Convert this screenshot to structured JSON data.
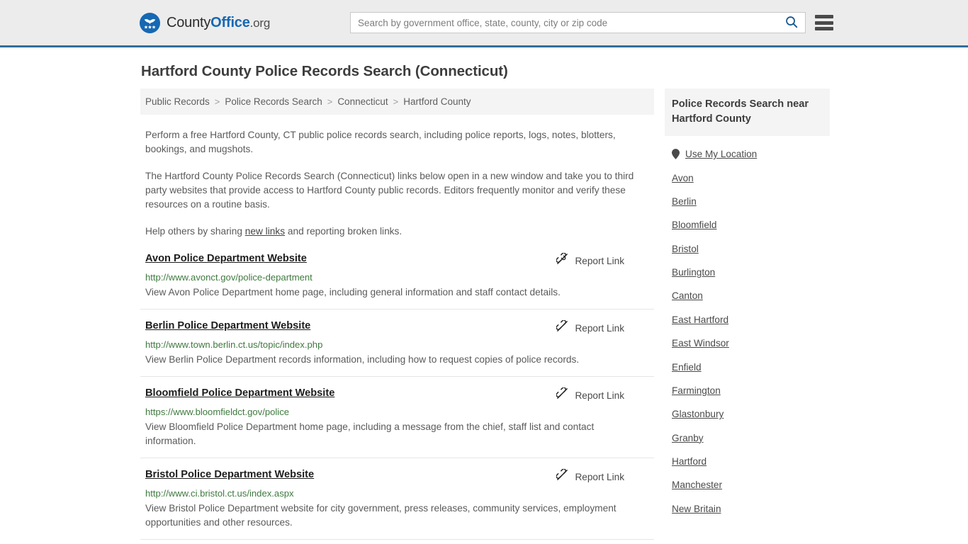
{
  "header": {
    "brand": {
      "part1": "County",
      "part2": "Office",
      "part3": ".org",
      "logo_icon": "eagle-shield-icon"
    },
    "search": {
      "placeholder": "Search by government office, state, county, city or zip code",
      "value": "",
      "search_icon": "search-icon"
    },
    "menu_icon": "hamburger-menu-icon",
    "background_color": "#ececec",
    "accent_color": "#336e9e"
  },
  "page": {
    "title": "Hartford County Police Records Search (Connecticut)"
  },
  "breadcrumb": {
    "separator": ">",
    "items": [
      {
        "label": "Public Records"
      },
      {
        "label": "Police Records Search"
      },
      {
        "label": "Connecticut"
      },
      {
        "label": "Hartford County"
      }
    ]
  },
  "intro": {
    "p1": "Perform a free Hartford County, CT public police records search, including police reports, logs, notes, blotters, bookings, and mugshots.",
    "p2": "The Hartford County Police Records Search (Connecticut) links below open in a new window and take you to third party websites that provide access to Hartford County public records. Editors frequently monitor and verify these resources on a routine basis.",
    "p3_before": "Help others by sharing ",
    "p3_link": "new links",
    "p3_after": " and reporting broken links."
  },
  "listings": {
    "report_link_label": "Report Link",
    "report_link_icon": "broken-link-icon",
    "url_color": "#3f7a3f",
    "items": [
      {
        "title": "Avon Police Department Website",
        "url": "http://www.avonct.gov/police-department",
        "description": "View Avon Police Department home page, including general information and staff contact details."
      },
      {
        "title": "Berlin Police Department Website",
        "url": "http://www.town.berlin.ct.us/topic/index.php",
        "description": "View Berlin Police Department records information, including how to request copies of police records."
      },
      {
        "title": "Bloomfield Police Department Website",
        "url": "https://www.bloomfieldct.gov/police",
        "description": "View Bloomfield Police Department home page, including a message from the chief, staff list and contact information."
      },
      {
        "title": "Bristol Police Department Website",
        "url": "http://www.ci.bristol.ct.us/index.aspx",
        "description": "View Bristol Police Department website for city government, press releases, community services, employment opportunities and other resources."
      }
    ]
  },
  "sidebar": {
    "heading": "Police Records Search near Hartford County",
    "items": [
      {
        "label": "Use My Location",
        "icon": "map-pin-icon"
      },
      {
        "label": "Avon",
        "icon": ""
      },
      {
        "label": "Berlin",
        "icon": ""
      },
      {
        "label": "Bloomfield",
        "icon": ""
      },
      {
        "label": "Bristol",
        "icon": ""
      },
      {
        "label": "Burlington",
        "icon": ""
      },
      {
        "label": "Canton",
        "icon": ""
      },
      {
        "label": "East Hartford",
        "icon": ""
      },
      {
        "label": "East Windsor",
        "icon": ""
      },
      {
        "label": "Enfield",
        "icon": ""
      },
      {
        "label": "Farmington",
        "icon": ""
      },
      {
        "label": "Glastonbury",
        "icon": ""
      },
      {
        "label": "Granby",
        "icon": ""
      },
      {
        "label": "Hartford",
        "icon": ""
      },
      {
        "label": "Manchester",
        "icon": ""
      },
      {
        "label": "New Britain",
        "icon": ""
      }
    ]
  }
}
